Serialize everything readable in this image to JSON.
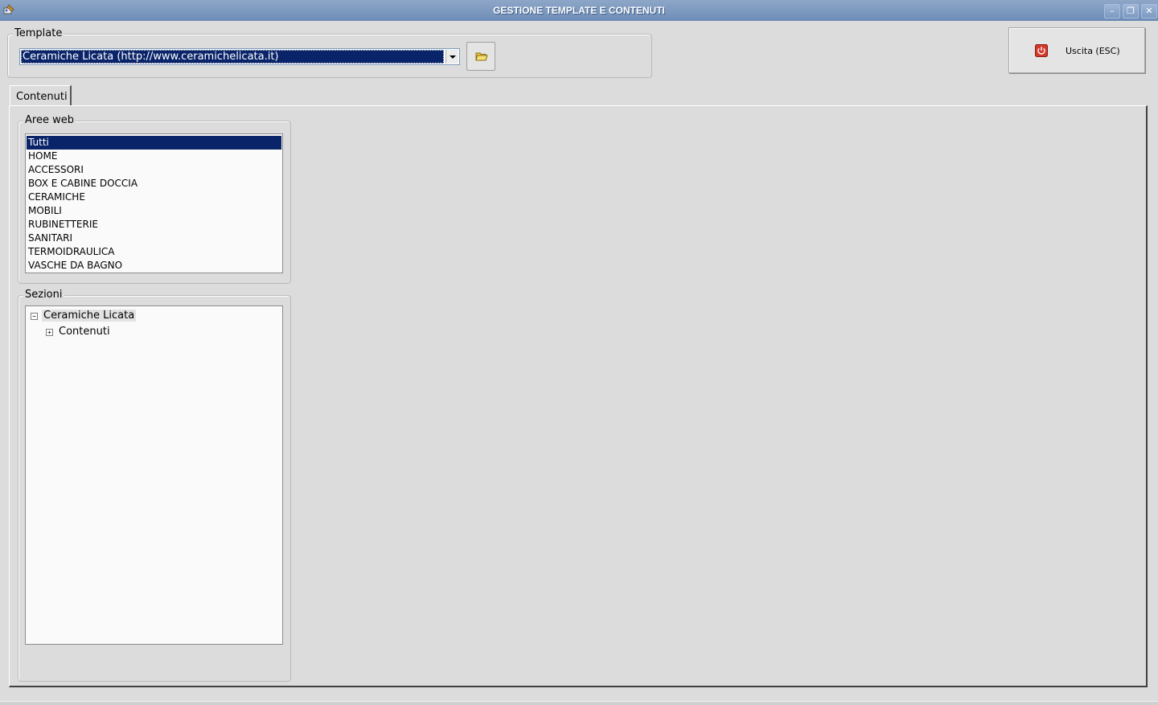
{
  "window": {
    "title": "GESTIONE TEMPLATE E CONTENUTI",
    "minimize_glyph": "–",
    "restore_glyph": "❐",
    "close_glyph": "✕"
  },
  "template_group": {
    "label": "Template",
    "selected_value": "Ceramiche Licata (http://www.ceramichelicata.it)",
    "browse_icon": "folder-icon"
  },
  "exit_button": {
    "label": "Uscita (ESC)",
    "icon": "power-icon"
  },
  "tabs": [
    {
      "label": "Contenuti",
      "active": true
    }
  ],
  "aree_web": {
    "label": "Aree web",
    "items": [
      "Tutti",
      "HOME",
      "ACCESSORI",
      "BOX E CABINE DOCCIA",
      "CERAMICHE",
      "MOBILI",
      "RUBINETTERIE",
      "SANITARI",
      "TERMOIDRAULICA",
      "VASCHE DA BAGNO"
    ],
    "selected_index": 0
  },
  "sezioni": {
    "label": "Sezioni",
    "tree": {
      "root": {
        "label": "Ceramiche Licata",
        "toggle": "−"
      },
      "child": {
        "label": "Contenuti",
        "toggle": "+"
      }
    }
  },
  "colors": {
    "selection": "#0a246a",
    "background": "#dcdcdc",
    "titlebar": "#7f9bc2"
  }
}
